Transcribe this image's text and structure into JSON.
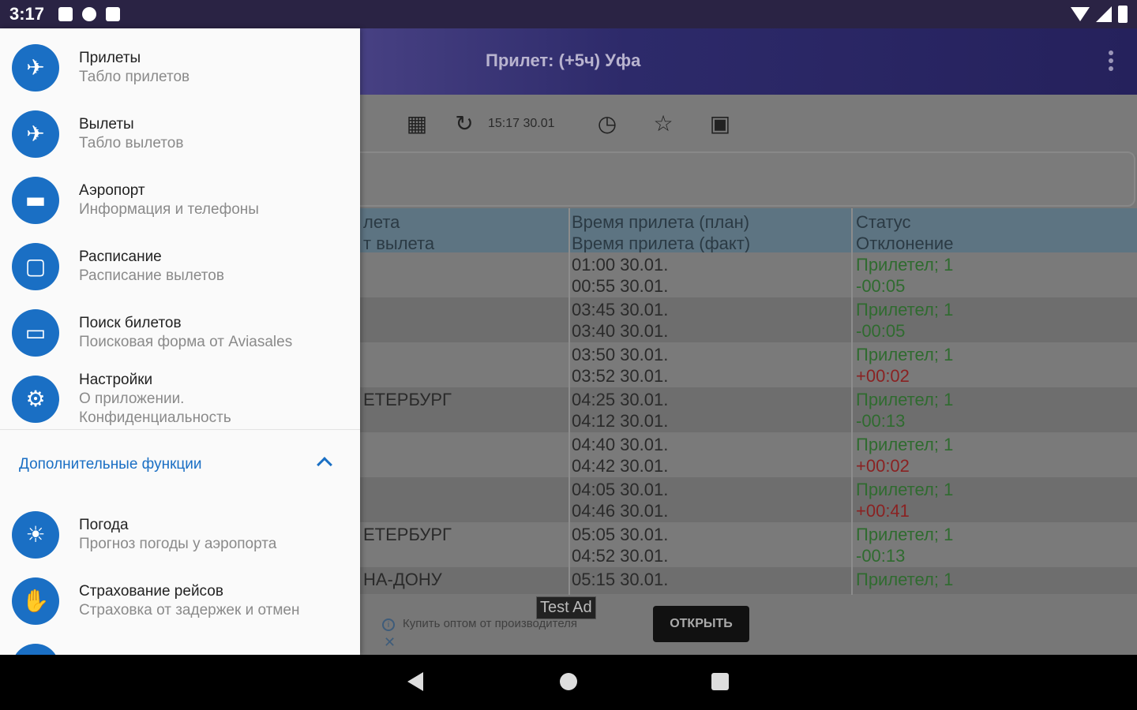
{
  "status_bar": {
    "time": "3:17"
  },
  "app_bar": {
    "title": "Прилет: (+5ч) Уфа"
  },
  "toolbar": {
    "timestamp": "15:17 30.01"
  },
  "table": {
    "headers": {
      "col1_line1": "лета",
      "col1_line2": "т вылета",
      "col2_line1": "Время прилета (план)",
      "col2_line2": "Время прилета (факт)",
      "col3_line1": "Статус",
      "col3_line2": "Отклонение"
    },
    "rows": [
      {
        "city": "",
        "plan": "01:00 30.01.",
        "fact": "00:55 30.01.",
        "status": "Прилетел; 1",
        "deviation": "-00:05"
      },
      {
        "city": "",
        "plan": "03:45 30.01.",
        "fact": "03:40 30.01.",
        "status": "Прилетел; 1",
        "deviation": "-00:05"
      },
      {
        "city": "",
        "plan": "03:50 30.01.",
        "fact": "03:52 30.01.",
        "status": "Прилетел; 1",
        "deviation": "+00:02"
      },
      {
        "city": "ЕТЕРБУРГ",
        "plan": "04:25 30.01.",
        "fact": "04:12 30.01.",
        "status": "Прилетел; 1",
        "deviation": "-00:13"
      },
      {
        "city": "",
        "plan": "04:40 30.01.",
        "fact": "04:42 30.01.",
        "status": "Прилетел; 1",
        "deviation": "+00:02"
      },
      {
        "city": "",
        "plan": "04:05 30.01.",
        "fact": "04:46 30.01.",
        "status": "Прилетел; 1",
        "deviation": "+00:41"
      },
      {
        "city": "ЕТЕРБУРГ",
        "plan": "05:05 30.01.",
        "fact": "04:52 30.01.",
        "status": "Прилетел; 1",
        "deviation": "-00:13"
      },
      {
        "city": "НА-ДОНУ",
        "plan": "05:15 30.01.",
        "fact": "",
        "status": "Прилетел; 1",
        "deviation": ""
      }
    ]
  },
  "ad": {
    "badge": "Test Ad",
    "text": "Купить оптом от производителя",
    "button": "ОТКРЫТЬ"
  },
  "drawer": {
    "items": [
      {
        "title": "Прилеты",
        "subtitle": "Табло прилетов",
        "icon": "plane-landing-icon"
      },
      {
        "title": "Вылеты",
        "subtitle": "Табло вылетов",
        "icon": "plane-takeoff-icon"
      },
      {
        "title": "Аэропорт",
        "subtitle": "Информация и телефоны",
        "icon": "bus-icon"
      },
      {
        "title": "Расписание",
        "subtitle": "Расписание вылетов",
        "icon": "calendar-icon"
      },
      {
        "title": "Поиск билетов",
        "subtitle": "Поисковая форма от Aviasales",
        "icon": "ticket-icon"
      },
      {
        "title": "Настройки",
        "subtitle": "О приложении.",
        "subtitle2": "Конфиденциальность",
        "icon": "settings-icon"
      }
    ],
    "section_label": "Дополнительные функции",
    "extra_items": [
      {
        "title": "Погода",
        "subtitle": "Прогноз погоды у аэропорта",
        "icon": "sun-icon"
      },
      {
        "title": "Страхование рейсов",
        "subtitle": "Страховка от задержек и отмен",
        "icon": "handshake-icon"
      }
    ]
  },
  "colors": {
    "accent": "#1a6fc4",
    "status_ok": "#2f6b2f",
    "deviation_late": "#8a2222"
  }
}
